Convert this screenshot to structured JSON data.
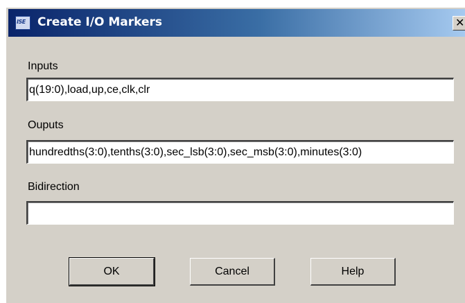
{
  "window": {
    "title": "Create I/O Markers",
    "icon": "ise-app-icon",
    "icon_text": "ISE",
    "close_glyph": "✕"
  },
  "fields": {
    "inputs": {
      "label": "Inputs",
      "value": "q(19:0),load,up,ce,clk,clr"
    },
    "outputs": {
      "label": "Ouputs",
      "value": "hundredths(3:0),tenths(3:0),sec_lsb(3:0),sec_msb(3:0),minutes(3:0)"
    },
    "bidirection": {
      "label": "Bidirection",
      "value": ""
    }
  },
  "buttons": {
    "ok": "OK",
    "cancel": "Cancel",
    "help": "Help"
  },
  "colors": {
    "titlebar_start": "#0a246a",
    "titlebar_end": "#a6caf0",
    "dialog_bg": "#d4d0c8"
  }
}
